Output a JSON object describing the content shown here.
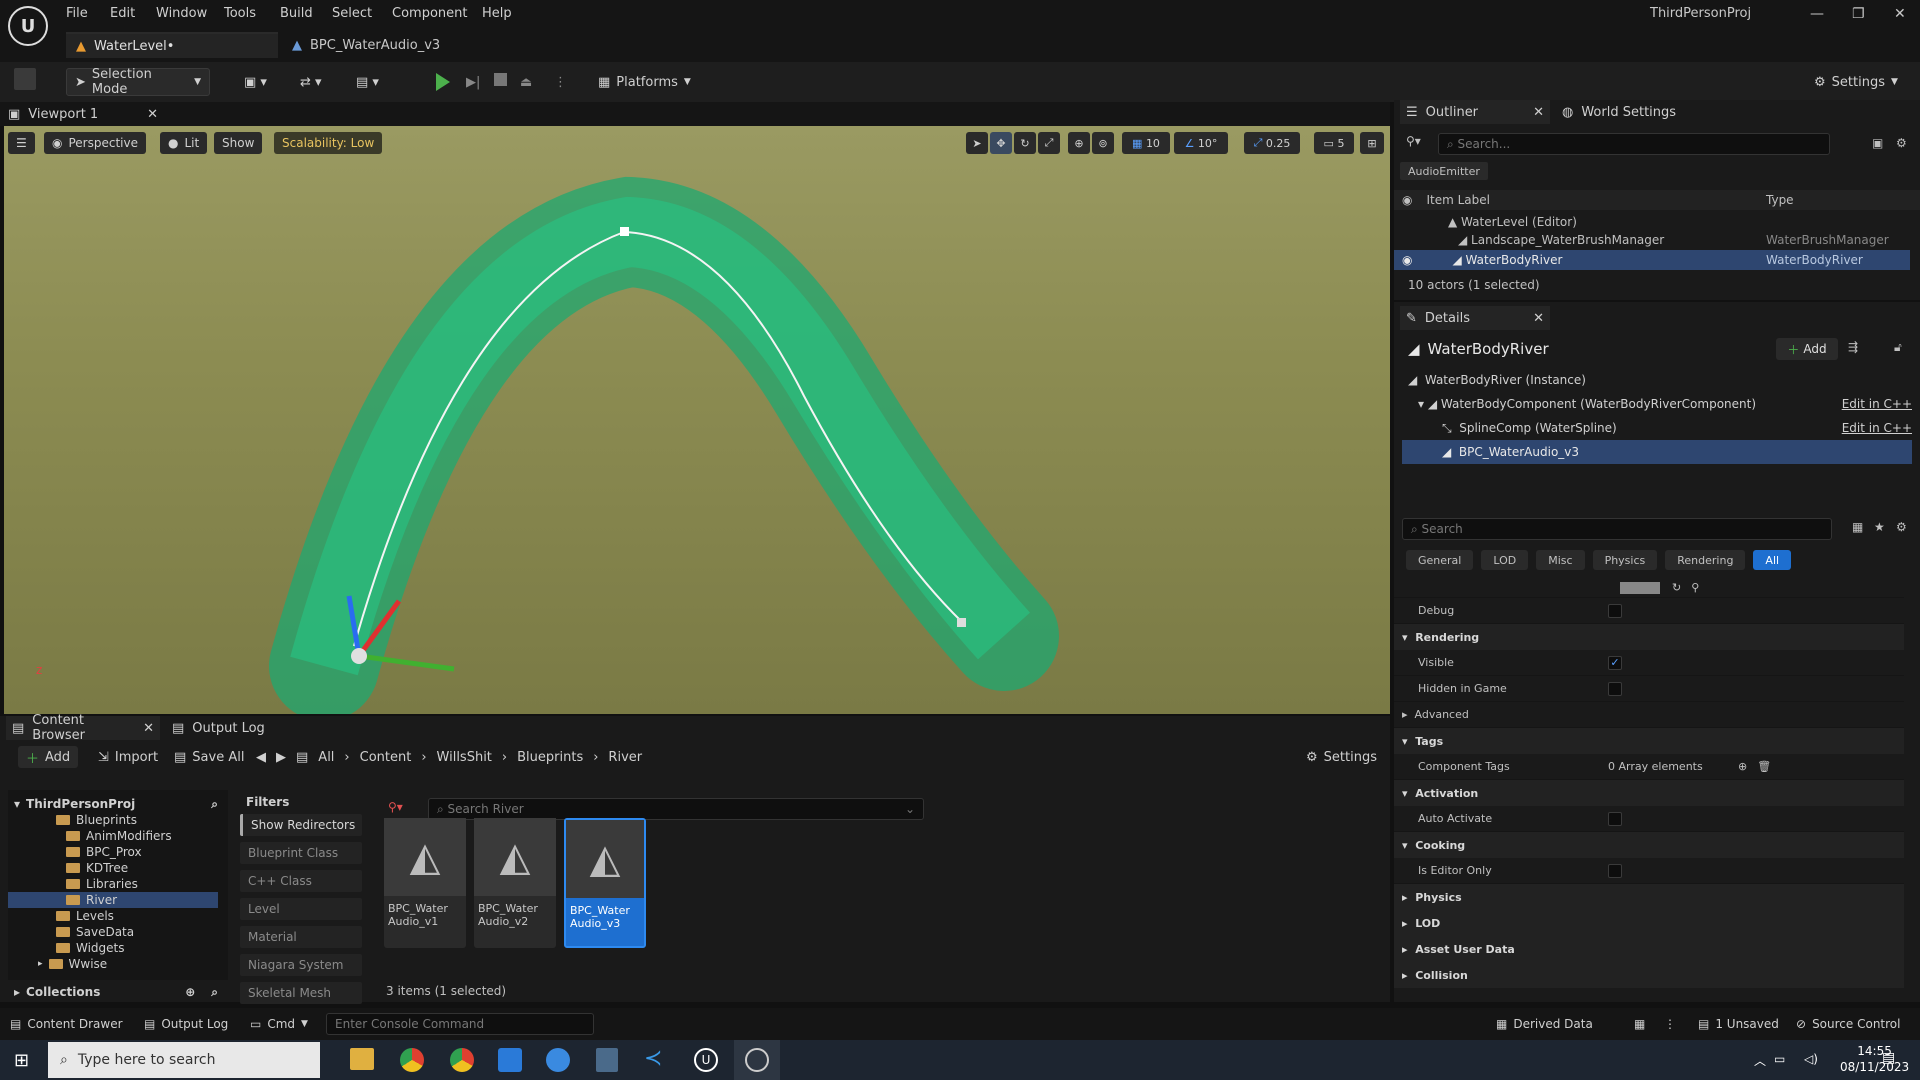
{
  "window": {
    "project_name": "ThirdPersonProj"
  },
  "menu": [
    "File",
    "Edit",
    "Window",
    "Tools",
    "Build",
    "Select",
    "Component",
    "Help"
  ],
  "doc_tabs": [
    {
      "label": "WaterLevel•"
    },
    {
      "label": "BPC_WaterAudio_v3"
    }
  ],
  "toolbar": {
    "selection_mode": "Selection Mode",
    "platforms": "Platforms",
    "settings": "Settings"
  },
  "viewport": {
    "tab": "Viewport 1",
    "perspective": "Perspective",
    "lit": "Lit",
    "show": "Show",
    "scalability": "Scalability: Low",
    "grid_snap": "10",
    "rot_snap": "10°",
    "scale_snap": "0.25",
    "cam_speed": "5"
  },
  "outliner": {
    "tab": "Outliner",
    "world_settings": "World Settings",
    "search_placeholder": "Search...",
    "filter_chip": "AudioEmitter",
    "col_label": "Item Label",
    "col_type": "Type",
    "rows": [
      {
        "label": "WaterLevel (Editor)",
        "type": ""
      },
      {
        "label": "Landscape_WaterBrushManager",
        "type": "WaterBrushManager"
      },
      {
        "label": "WaterBodyRiver",
        "type": "WaterBodyRiver"
      }
    ],
    "summary": "10 actors (1 selected)"
  },
  "details": {
    "tab": "Details",
    "actor": "WaterBodyRiver",
    "add": "Add",
    "components": [
      {
        "label": "WaterBodyRiver (Instance)",
        "edit": ""
      },
      {
        "label": "WaterBodyComponent (WaterBodyRiverComponent)",
        "edit": "Edit in C++"
      },
      {
        "label": "SplineComp (WaterSpline)",
        "edit": "Edit in C++"
      },
      {
        "label": "BPC_WaterAudio_v3",
        "edit": ""
      }
    ],
    "search_placeholder": "Search",
    "categories": [
      "General",
      "LOD",
      "Misc",
      "Physics",
      "Rendering",
      "All"
    ],
    "props": {
      "debug": "Debug",
      "rendering": "Rendering",
      "visible": "Visible",
      "hidden": "Hidden in Game",
      "advanced": "Advanced",
      "tags": "Tags",
      "component_tags": "Component Tags",
      "array": "0 Array elements",
      "activation": "Activation",
      "auto_activate": "Auto Activate",
      "cooking": "Cooking",
      "editor_only": "Is Editor Only",
      "physics": "Physics",
      "lod": "LOD",
      "asset_user_data": "Asset User Data",
      "collision": "Collision"
    }
  },
  "content_browser": {
    "tab": "Content Browser",
    "output_log": "Output Log",
    "add": "Add",
    "import": "Import",
    "save_all": "Save All",
    "breadcrumb": [
      "All",
      "Content",
      "WillsShit",
      "Blueprints",
      "River"
    ],
    "settings": "Settings",
    "root": "ThirdPersonProj",
    "tree": [
      "Blueprints",
      "AnimModifiers",
      "BPC_Prox",
      "KDTree",
      "Libraries",
      "River",
      "Levels",
      "SaveData",
      "Widgets",
      "Wwise"
    ],
    "collections": "Collections",
    "filters": "Filters",
    "filter_items": [
      "Show Redirectors",
      "Blueprint Class",
      "C++ Class",
      "Level",
      "Material",
      "Niagara System",
      "Skeletal Mesh"
    ],
    "search_placeholder": "Search River",
    "assets": [
      {
        "line1": "BPC_Water",
        "line2": "Audio_v1"
      },
      {
        "line1": "BPC_Water",
        "line2": "Audio_v2"
      },
      {
        "line1": "BPC_Water",
        "line2": "Audio_v3"
      }
    ],
    "count": "3 items (1 selected)"
  },
  "statusbar": {
    "content_drawer": "Content Drawer",
    "output_log": "Output Log",
    "cmd": "Cmd",
    "console_placeholder": "Enter Console Command",
    "derived": "Derived Data",
    "unsaved": "1 Unsaved",
    "source_control": "Source Control"
  },
  "taskbar": {
    "search": "Type here to search",
    "time": "14:55",
    "date": "08/11/2023"
  }
}
